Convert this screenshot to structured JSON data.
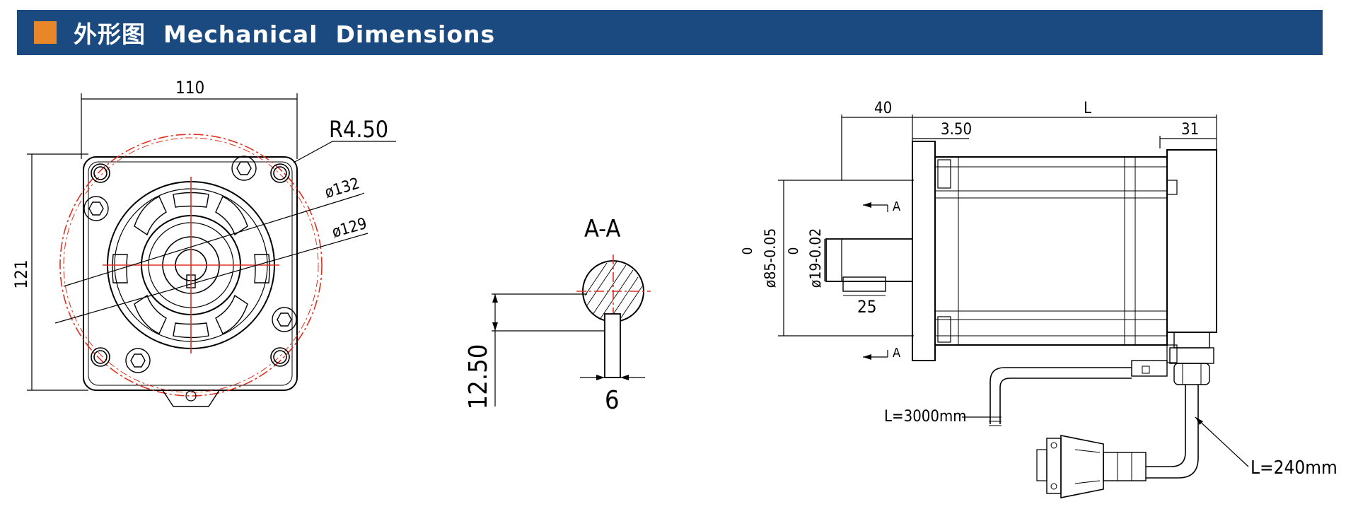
{
  "header": {
    "title": "外形图  Mechanical  Dimensions",
    "accent_color": "#e8862a",
    "bar_color": "#1b4a80"
  },
  "front_view": {
    "width_label": "110",
    "height_label": "121",
    "radius_label": "R4.50",
    "dia_outer_label": "ø132",
    "dia_inner_label": "ø129"
  },
  "section_view": {
    "title": "A-A",
    "depth_label": "12.50",
    "key_width_label": "6"
  },
  "side_view": {
    "shaft_len_label": "40",
    "body_len_label": "L",
    "flange_label": "3.50",
    "rear_label": "31",
    "key_len_label": "25",
    "pilot_dia_label": "ø85-0.05",
    "pilot_tol_top": "0",
    "shaft_dia_label": "ø19-0.02",
    "shaft_tol_top": "0",
    "section_mark_top": "A",
    "section_mark_bottom": "A",
    "motor_cable_label": "L=3000mm",
    "encoder_cable_label": "L=240mm"
  }
}
